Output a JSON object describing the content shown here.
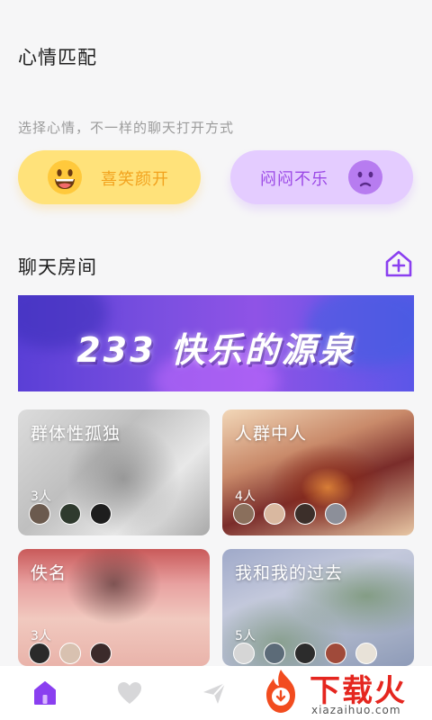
{
  "mood": {
    "title": "心情匹配",
    "subtitle": "选择心情，不一样的聊天打开方式",
    "happy_label": "喜笑颜开",
    "sad_label": "闷闷不乐"
  },
  "rooms": {
    "title": "聊天房间",
    "banner_text": "233 快乐的源泉",
    "cards": [
      {
        "name": "群体性孤独",
        "count": "3人"
      },
      {
        "name": "人群中人",
        "count": "4人"
      },
      {
        "name": "佚名",
        "count": "3人"
      },
      {
        "name": "我和我的过去",
        "count": "5人"
      }
    ]
  },
  "tabbar": {
    "icons": [
      "home-icon",
      "heart-icon",
      "send-icon"
    ],
    "active": "home-icon",
    "accent": "#8a3ff0"
  },
  "watermark": {
    "brand": "下载火",
    "url": "xiazaihuo.com"
  },
  "colors": {
    "happy_bg": "#ffe27a",
    "happy_text": "#f2a21d",
    "sad_bg": "#e4ccff",
    "sad_text": "#9b49e6"
  }
}
